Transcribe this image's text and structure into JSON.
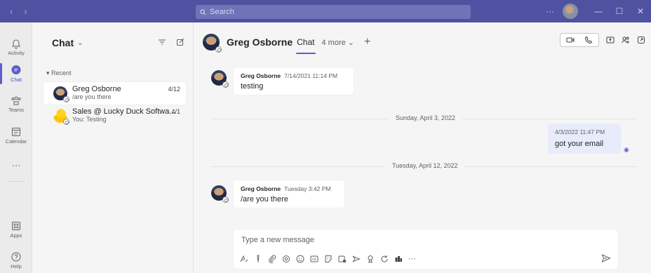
{
  "titlebar": {
    "back": "‹",
    "forward": "›",
    "search_placeholder": "Search",
    "more": "···",
    "minimize": "—",
    "maximize": "☐",
    "close": "✕"
  },
  "rail": {
    "activity": "Activity",
    "chat": "Chat",
    "teams": "Teams",
    "calendar": "Calendar",
    "more": "···",
    "apps": "Apps",
    "help": "Help"
  },
  "chatlist": {
    "title": "Chat",
    "recent_label": "Recent",
    "items": [
      {
        "name": "Greg Osborne",
        "preview": "/are you there",
        "date": "4/12"
      },
      {
        "name": "Sales @ Lucky Duck Softwa...",
        "preview": "You: Testing",
        "date": "4/1"
      }
    ]
  },
  "conversation": {
    "contact_name": "Greg Osborne",
    "tab_label": "Chat",
    "more_tabs": "4 more",
    "messages": [
      {
        "sender": "Greg Osborne",
        "time": "7/14/2021 11:14 PM",
        "text": "testing"
      },
      {
        "sender": "",
        "time": "4/3/2022 11:47 PM",
        "text": "got your email"
      },
      {
        "sender": "Greg Osborne",
        "time": "Tuesday 3:42 PM",
        "text": "/are you there"
      }
    ],
    "dividers": [
      "Sunday, April 3, 2022",
      "Tuesday, April 12, 2022"
    ],
    "compose_placeholder": "Type a new message"
  },
  "colors": {
    "titlebar": "#4f52a0",
    "accent": "#5b5fc7",
    "own_message_bg": "#e8ebfa"
  }
}
